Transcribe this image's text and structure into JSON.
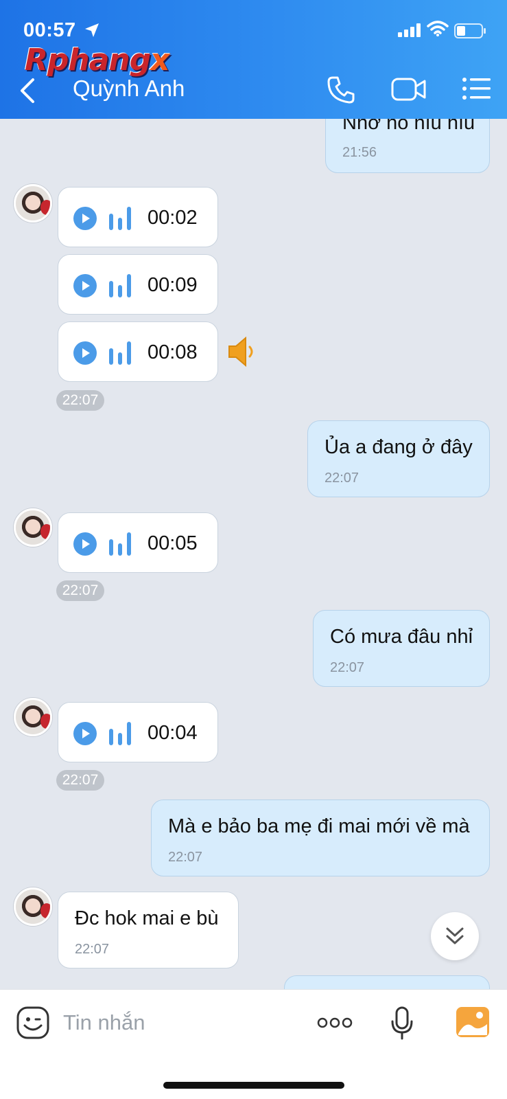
{
  "status_bar": {
    "time": "00:57"
  },
  "watermark": "Rphangx",
  "header": {
    "title": "Quỳnh Anh"
  },
  "messages": {
    "m0": {
      "text": "Nhớ nó hìu hìu",
      "time": "21:56"
    },
    "v1": {
      "duration": "00:02"
    },
    "v2": {
      "duration": "00:09"
    },
    "v3": {
      "duration": "00:08"
    },
    "chip1": "22:07",
    "m1": {
      "text": "Ủa a đang ở đây",
      "time": "22:07"
    },
    "v4": {
      "duration": "00:05"
    },
    "chip2": "22:07",
    "m2": {
      "text": "Có mưa đâu nhỉ",
      "time": "22:07"
    },
    "v5": {
      "duration": "00:04"
    },
    "chip3": "22:07",
    "m3": {
      "text": "Mà e bảo ba mẹ đi mai mới về mà",
      "time": "22:07"
    },
    "m4": {
      "text": "Đc hok mai e bù",
      "time": "22:07"
    }
  },
  "input": {
    "placeholder": "Tin nhắn"
  },
  "colors": {
    "header": "#2f8cf0",
    "accent": "#4b9be8",
    "outgoing": "#d7ecfc",
    "background": "#e3e7ee"
  }
}
